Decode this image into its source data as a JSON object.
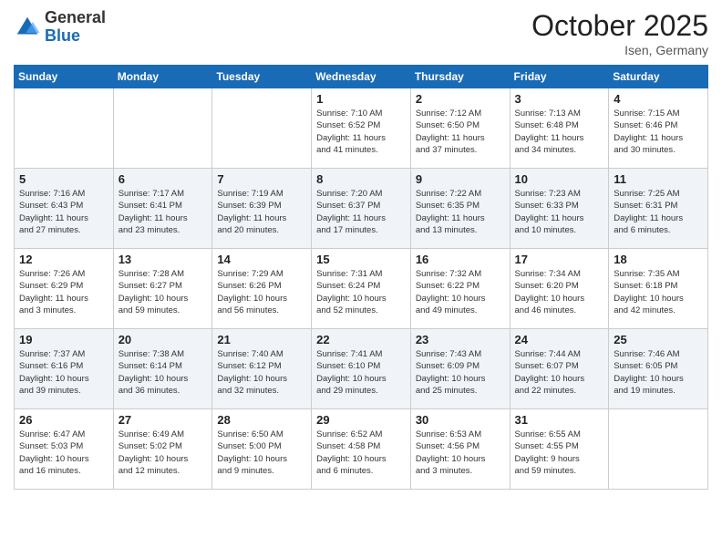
{
  "header": {
    "logo_line1": "General",
    "logo_line2": "Blue",
    "month": "October 2025",
    "location": "Isen, Germany"
  },
  "days_of_week": [
    "Sunday",
    "Monday",
    "Tuesday",
    "Wednesday",
    "Thursday",
    "Friday",
    "Saturday"
  ],
  "weeks": [
    [
      {
        "day": "",
        "info": ""
      },
      {
        "day": "",
        "info": ""
      },
      {
        "day": "",
        "info": ""
      },
      {
        "day": "1",
        "info": "Sunrise: 7:10 AM\nSunset: 6:52 PM\nDaylight: 11 hours\nand 41 minutes."
      },
      {
        "day": "2",
        "info": "Sunrise: 7:12 AM\nSunset: 6:50 PM\nDaylight: 11 hours\nand 37 minutes."
      },
      {
        "day": "3",
        "info": "Sunrise: 7:13 AM\nSunset: 6:48 PM\nDaylight: 11 hours\nand 34 minutes."
      },
      {
        "day": "4",
        "info": "Sunrise: 7:15 AM\nSunset: 6:46 PM\nDaylight: 11 hours\nand 30 minutes."
      }
    ],
    [
      {
        "day": "5",
        "info": "Sunrise: 7:16 AM\nSunset: 6:43 PM\nDaylight: 11 hours\nand 27 minutes."
      },
      {
        "day": "6",
        "info": "Sunrise: 7:17 AM\nSunset: 6:41 PM\nDaylight: 11 hours\nand 23 minutes."
      },
      {
        "day": "7",
        "info": "Sunrise: 7:19 AM\nSunset: 6:39 PM\nDaylight: 11 hours\nand 20 minutes."
      },
      {
        "day": "8",
        "info": "Sunrise: 7:20 AM\nSunset: 6:37 PM\nDaylight: 11 hours\nand 17 minutes."
      },
      {
        "day": "9",
        "info": "Sunrise: 7:22 AM\nSunset: 6:35 PM\nDaylight: 11 hours\nand 13 minutes."
      },
      {
        "day": "10",
        "info": "Sunrise: 7:23 AM\nSunset: 6:33 PM\nDaylight: 11 hours\nand 10 minutes."
      },
      {
        "day": "11",
        "info": "Sunrise: 7:25 AM\nSunset: 6:31 PM\nDaylight: 11 hours\nand 6 minutes."
      }
    ],
    [
      {
        "day": "12",
        "info": "Sunrise: 7:26 AM\nSunset: 6:29 PM\nDaylight: 11 hours\nand 3 minutes."
      },
      {
        "day": "13",
        "info": "Sunrise: 7:28 AM\nSunset: 6:27 PM\nDaylight: 10 hours\nand 59 minutes."
      },
      {
        "day": "14",
        "info": "Sunrise: 7:29 AM\nSunset: 6:26 PM\nDaylight: 10 hours\nand 56 minutes."
      },
      {
        "day": "15",
        "info": "Sunrise: 7:31 AM\nSunset: 6:24 PM\nDaylight: 10 hours\nand 52 minutes."
      },
      {
        "day": "16",
        "info": "Sunrise: 7:32 AM\nSunset: 6:22 PM\nDaylight: 10 hours\nand 49 minutes."
      },
      {
        "day": "17",
        "info": "Sunrise: 7:34 AM\nSunset: 6:20 PM\nDaylight: 10 hours\nand 46 minutes."
      },
      {
        "day": "18",
        "info": "Sunrise: 7:35 AM\nSunset: 6:18 PM\nDaylight: 10 hours\nand 42 minutes."
      }
    ],
    [
      {
        "day": "19",
        "info": "Sunrise: 7:37 AM\nSunset: 6:16 PM\nDaylight: 10 hours\nand 39 minutes."
      },
      {
        "day": "20",
        "info": "Sunrise: 7:38 AM\nSunset: 6:14 PM\nDaylight: 10 hours\nand 36 minutes."
      },
      {
        "day": "21",
        "info": "Sunrise: 7:40 AM\nSunset: 6:12 PM\nDaylight: 10 hours\nand 32 minutes."
      },
      {
        "day": "22",
        "info": "Sunrise: 7:41 AM\nSunset: 6:10 PM\nDaylight: 10 hours\nand 29 minutes."
      },
      {
        "day": "23",
        "info": "Sunrise: 7:43 AM\nSunset: 6:09 PM\nDaylight: 10 hours\nand 25 minutes."
      },
      {
        "day": "24",
        "info": "Sunrise: 7:44 AM\nSunset: 6:07 PM\nDaylight: 10 hours\nand 22 minutes."
      },
      {
        "day": "25",
        "info": "Sunrise: 7:46 AM\nSunset: 6:05 PM\nDaylight: 10 hours\nand 19 minutes."
      }
    ],
    [
      {
        "day": "26",
        "info": "Sunrise: 6:47 AM\nSunset: 5:03 PM\nDaylight: 10 hours\nand 16 minutes."
      },
      {
        "day": "27",
        "info": "Sunrise: 6:49 AM\nSunset: 5:02 PM\nDaylight: 10 hours\nand 12 minutes."
      },
      {
        "day": "28",
        "info": "Sunrise: 6:50 AM\nSunset: 5:00 PM\nDaylight: 10 hours\nand 9 minutes."
      },
      {
        "day": "29",
        "info": "Sunrise: 6:52 AM\nSunset: 4:58 PM\nDaylight: 10 hours\nand 6 minutes."
      },
      {
        "day": "30",
        "info": "Sunrise: 6:53 AM\nSunset: 4:56 PM\nDaylight: 10 hours\nand 3 minutes."
      },
      {
        "day": "31",
        "info": "Sunrise: 6:55 AM\nSunset: 4:55 PM\nDaylight: 9 hours\nand 59 minutes."
      },
      {
        "day": "",
        "info": ""
      }
    ]
  ]
}
